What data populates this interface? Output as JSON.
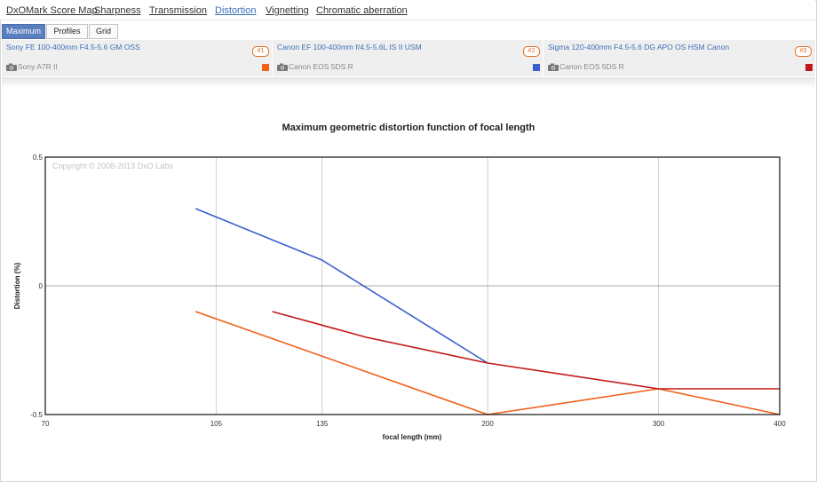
{
  "nav": {
    "items": [
      {
        "label": "DxOMark Score Map",
        "active": false
      },
      {
        "label": "Sharpness",
        "active": false
      },
      {
        "label": "Transmission",
        "active": false
      },
      {
        "label": "Distortion",
        "active": true
      },
      {
        "label": "Vignetting",
        "active": false
      },
      {
        "label": "Chromatic aberration",
        "active": false
      }
    ]
  },
  "subtabs": [
    {
      "label": "Maximum",
      "active": true
    },
    {
      "label": "Profiles",
      "active": false
    },
    {
      "label": "Grid",
      "active": false
    }
  ],
  "lenses": [
    {
      "name": "Sony FE 100-400mm F4.5-5.6 GM OSS",
      "badge": "#1",
      "camera": "Sony A7R II",
      "color": "#f06018"
    },
    {
      "name": "Canon EF 100-400mm f/4.5-5.6L IS II USM",
      "badge": "#2",
      "camera": "Canon EOS 5DS R",
      "color": "#3a5fcd"
    },
    {
      "name": "Sigma 120-400mm F4.5-5.6 DG APO OS HSM Canon",
      "badge": "#3",
      "camera": "Canon EOS 5DS R",
      "color": "#c01818"
    }
  ],
  "chart_data": {
    "type": "line",
    "title": "Maximum geometric distortion function of focal length",
    "xlabel": "focal length (mm)",
    "ylabel": "Distortion (%)",
    "x_scale": "log",
    "xlim": [
      70,
      400
    ],
    "ylim": [
      -0.5,
      0.5
    ],
    "x_ticks": [
      70,
      105,
      135,
      200,
      300,
      400
    ],
    "y_ticks": [
      0.5,
      0,
      -0.5
    ],
    "grid": true,
    "watermark": "Copyright © 2008-2013 DxO Labs",
    "series": [
      {
        "name": "Canon EF 100-400mm f/4.5-5.6L IS II USM",
        "color": "#3a5fcd",
        "x": [
          100,
          135,
          200
        ],
        "y": [
          0.3,
          0.1,
          -0.3
        ]
      },
      {
        "name": "Sony FE 100-400mm F4.5-5.6 GM OSS",
        "color": "#f06018",
        "x": [
          100,
          200,
          300,
          400
        ],
        "y": [
          -0.1,
          -0.5,
          -0.4,
          -0.5
        ]
      },
      {
        "name": "Sigma 120-400mm F4.5-5.6 DG APO OS HSM Canon",
        "color": "#c01818",
        "x": [
          120,
          150,
          200,
          300,
          400
        ],
        "y": [
          -0.1,
          -0.2,
          -0.3,
          -0.4,
          -0.4
        ]
      }
    ]
  }
}
